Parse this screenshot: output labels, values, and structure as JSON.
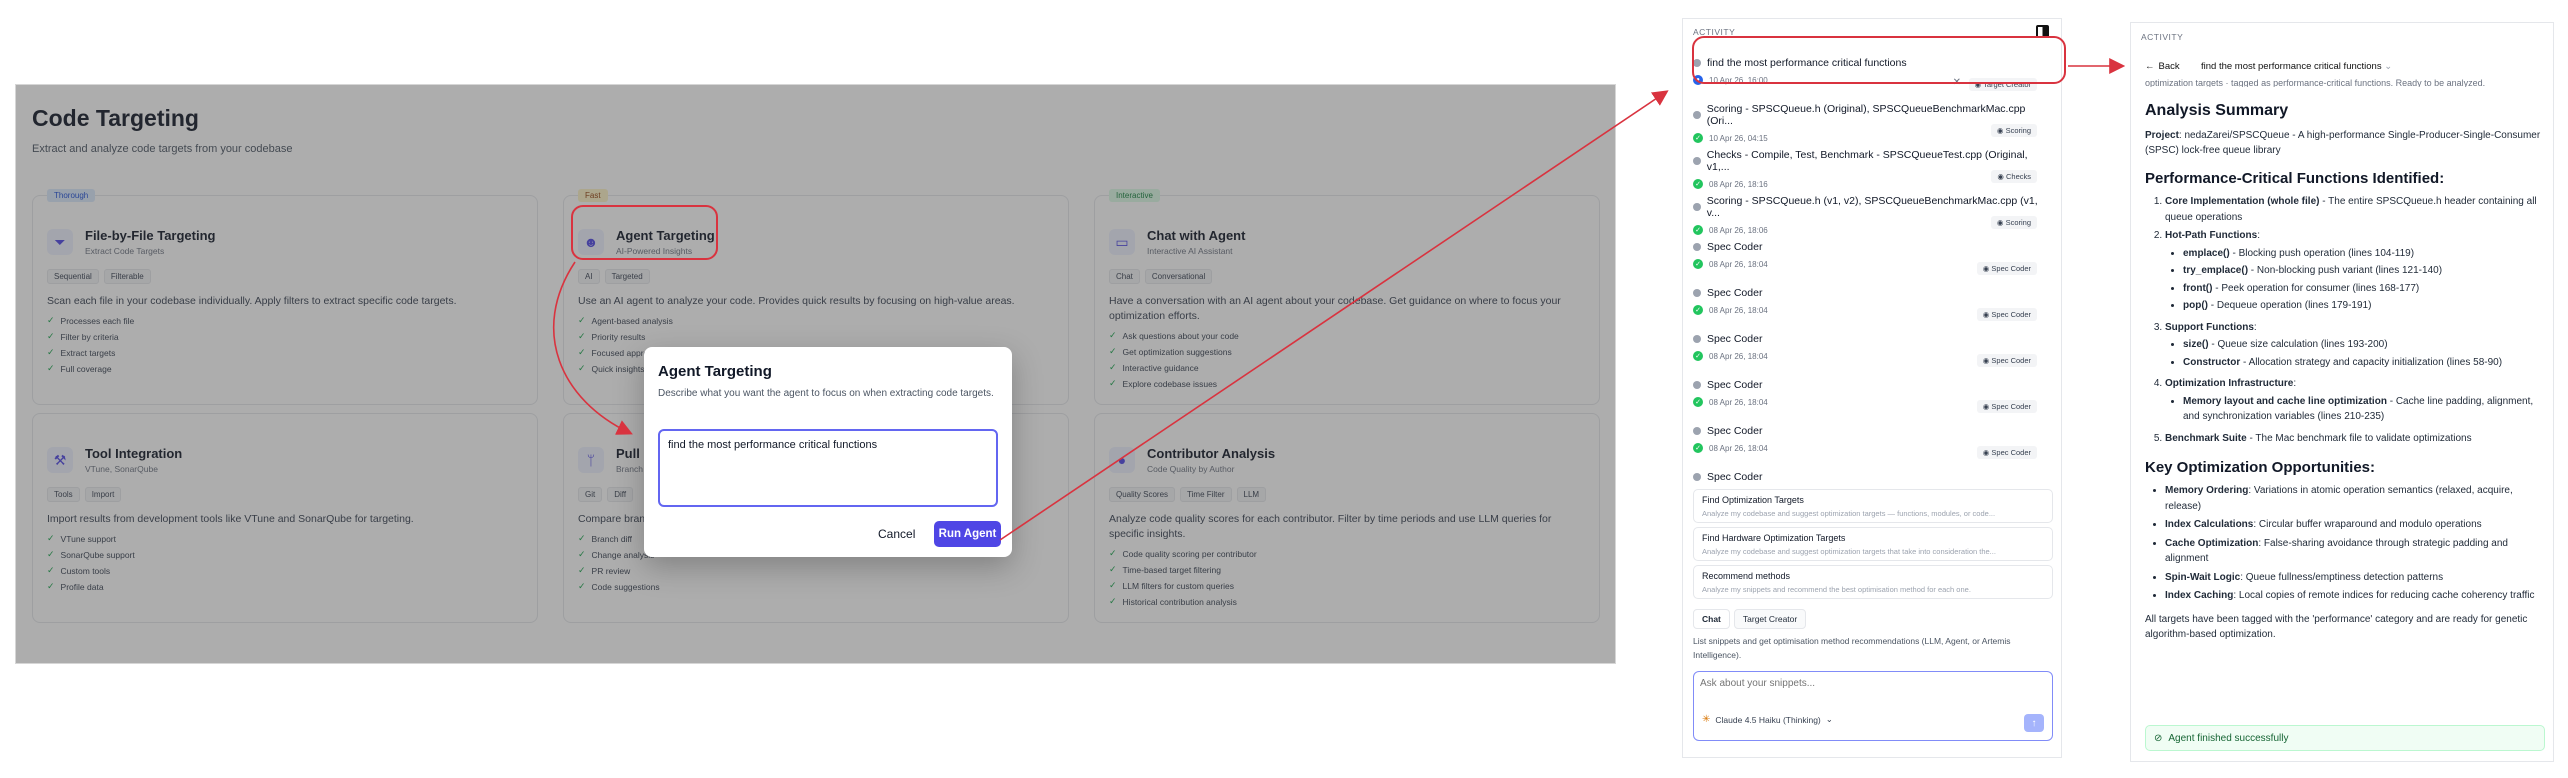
{
  "screen1": {
    "title": "Code Targeting",
    "subtitle": "Extract and analyze code targets from your codebase",
    "cards": [
      {
        "tag": "Thorough",
        "icon": "filter-icon",
        "title": "File-by-File Targeting",
        "subtitle": "Extract Code Targets",
        "chips": [
          "Sequential",
          "Filterable"
        ],
        "desc": "Scan each file in your codebase individually. Apply filters to extract specific code targets.",
        "bullets": [
          "Processes each file",
          "Filter by criteria",
          "Extract targets",
          "Full coverage"
        ]
      },
      {
        "tag": "Fast",
        "icon": "robot-icon",
        "title": "Agent Targeting",
        "subtitle": "AI-Powered Insights",
        "chips": [
          "AI",
          "Targeted"
        ],
        "desc": "Use an AI agent to analyze your code. Provides quick results by focusing on high-value areas.",
        "bullets": [
          "Agent-based analysis",
          "Priority results",
          "Focused approach",
          "Quick insights"
        ]
      },
      {
        "tag": "Interactive",
        "icon": "chat-icon",
        "title": "Chat with Agent",
        "subtitle": "Interactive AI Assistant",
        "chips": [
          "Chat",
          "Conversational"
        ],
        "desc": "Have a conversation with an AI agent about your codebase. Get guidance on where to focus your optimization efforts.",
        "bullets": [
          "Ask questions about your code",
          "Get optimization suggestions",
          "Interactive guidance",
          "Explore codebase issues"
        ]
      },
      {
        "tag": "",
        "icon": "wrench-icon",
        "title": "Tool Integration",
        "subtitle": "VTune, SonarQube",
        "chips": [
          "Tools",
          "Import"
        ],
        "desc": "Import results from development tools like VTune and SonarQube for targeting.",
        "bullets": [
          "VTune support",
          "SonarQube support",
          "Custom tools",
          "Profile data"
        ]
      },
      {
        "tag": "",
        "icon": "branch-icon",
        "title": "Pull",
        "subtitle": "Branch",
        "chips": [
          "Git",
          "Diff"
        ],
        "desc": "Compare branches",
        "bullets": [
          "Branch diff",
          "Change analysis",
          "PR review",
          "Code suggestions"
        ]
      },
      {
        "tag": "",
        "icon": "person-icon",
        "title": "Contributor Analysis",
        "subtitle": "Code Quality by Author",
        "chips": [
          "Quality Scores",
          "Time Filter",
          "LLM"
        ],
        "desc": "Analyze code quality scores for each contributor. Filter by time periods and use LLM queries for specific insights.",
        "bullets": [
          "Code quality scoring per contributor",
          "Time-based target filtering",
          "LLM filters for custom queries",
          "Historical contribution analysis"
        ]
      }
    ],
    "modal": {
      "title": "Agent Targeting",
      "desc": "Describe what you want the agent to focus on when extracting code targets.",
      "value": "find the most performance critical functions",
      "cancel": "Cancel",
      "run": "Run Agent"
    }
  },
  "activity": {
    "header": "ACTIVITY",
    "items": [
      {
        "title": "find the most performance critical functions",
        "meta": "10 Apr 26, 16:00",
        "badge": "Target Creator",
        "status": "running"
      },
      {
        "title": "Scoring - SPSCQueue.h (Original), SPSCQueueBenchmarkMac.cpp (Ori...",
        "meta": "10 Apr 26, 04:15",
        "badge": "Scoring",
        "status": "done"
      },
      {
        "title": "Checks - Compile, Test, Benchmark - SPSCQueueTest.cpp (Original, v1,...",
        "meta": "08 Apr 26, 18:16",
        "badge": "Checks",
        "status": "done"
      },
      {
        "title": "Scoring - SPSCQueue.h (v1, v2), SPSCQueueBenchmarkMac.cpp (v1, v...",
        "meta": "08 Apr 26, 18:06",
        "badge": "Scoring",
        "status": "done"
      },
      {
        "title": "Spec Coder",
        "meta": "08 Apr 26, 18:04",
        "badge": "Spec Coder",
        "status": "done"
      },
      {
        "title": "Spec Coder",
        "meta": "08 Apr 26, 18:04",
        "badge": "Spec Coder",
        "status": "done"
      },
      {
        "title": "Spec Coder",
        "meta": "08 Apr 26, 18:04",
        "badge": "Spec Coder",
        "status": "done"
      },
      {
        "title": "Spec Coder",
        "meta": "08 Apr 26, 18:04",
        "badge": "Spec Coder",
        "status": "done"
      },
      {
        "title": "Spec Coder",
        "meta": "08 Apr 26, 18:04",
        "badge": "Spec Coder",
        "status": "done"
      },
      {
        "title": "Spec Coder",
        "meta": "",
        "badge": "",
        "status": "done"
      }
    ],
    "suggestions": [
      {
        "title": "Find Optimization Targets",
        "desc": "Analyze my codebase and suggest optimization targets — functions, modules, or code..."
      },
      {
        "title": "Find Hardware Optimization Targets",
        "desc": "Analyze my codebase and suggest optimization targets that take into consideration the..."
      },
      {
        "title": "Recommend methods",
        "desc": "Analyze my snippets and recommend the best optimisation method for each one."
      }
    ],
    "tabs": [
      "Chat",
      "Target Creator"
    ],
    "hint": "List snippets and get optimisation method recommendations (LLM, Agent, or Artemis Intelligence).",
    "chat_placeholder": "Ask about your snippets...",
    "model": "Claude 4.5 Haiku (Thinking)"
  },
  "detail": {
    "header": "ACTIVITY",
    "back": "Back",
    "query": "find the most performance critical functions",
    "clipped": "optimization targets · tagged as performance-critical functions. Ready to be analyzed.",
    "summary_heading": "Analysis Summary",
    "project_label": "Project",
    "project_text": ": nedaZarei/SPSCQueue - A high-performance Single-Producer-Single-Consumer (SPSC) lock-free queue library",
    "critical_heading": "Performance-Critical Functions Identified:",
    "core_label": "Core Implementation (whole file)",
    "core_text": " - The entire SPSCQueue.h header containing all queue operations",
    "hot_label": "Hot-Path Functions",
    "hot_items": [
      {
        "name": "emplace()",
        "text": " - Blocking push operation (lines 104-119)"
      },
      {
        "name": "try_emplace()",
        "text": " - Non-blocking push variant (lines 121-140)"
      },
      {
        "name": "front()",
        "text": " - Peek operation for consumer (lines 168-177)"
      },
      {
        "name": "pop()",
        "text": " - Dequeue operation (lines 179-191)"
      }
    ],
    "support_label": "Support Functions",
    "support_items": [
      {
        "name": "size()",
        "text": " - Queue size calculation (lines 193-200)"
      },
      {
        "name": "Constructor",
        "text": " - Allocation strategy and capacity initialization (lines 58-90)"
      }
    ],
    "infra_label": "Optimization Infrastructure",
    "infra_items": [
      {
        "name": "Memory layout and cache line optimization",
        "text": " - Cache line padding, alignment, and synchronization variables (lines 210-235)"
      }
    ],
    "bench_label": "Benchmark Suite",
    "bench_text": " - The Mac benchmark file to validate optimizations",
    "opp_heading": "Key Optimization Opportunities:",
    "opps": [
      {
        "name": "Memory Ordering",
        "text": ": Variations in atomic operation semantics (relaxed, acquire, release)"
      },
      {
        "name": "Index Calculations",
        "text": ": Circular buffer wraparound and modulo operations"
      },
      {
        "name": "Cache Optimization",
        "text": ": False-sharing avoidance through strategic padding and alignment"
      },
      {
        "name": "Spin-Wait Logic",
        "text": ": Queue fullness/emptiness detection patterns"
      },
      {
        "name": "Index Caching",
        "text": ": Local copies of remote indices for reducing cache coherency traffic"
      }
    ],
    "footer": "All targets have been tagged with the 'performance' category and are ready for genetic algorithm-based optimization.",
    "success": "Agent finished successfully"
  },
  "colors": {
    "accent": "#4f46e5",
    "annotation": "#d9333f",
    "success": "#22c55e"
  }
}
